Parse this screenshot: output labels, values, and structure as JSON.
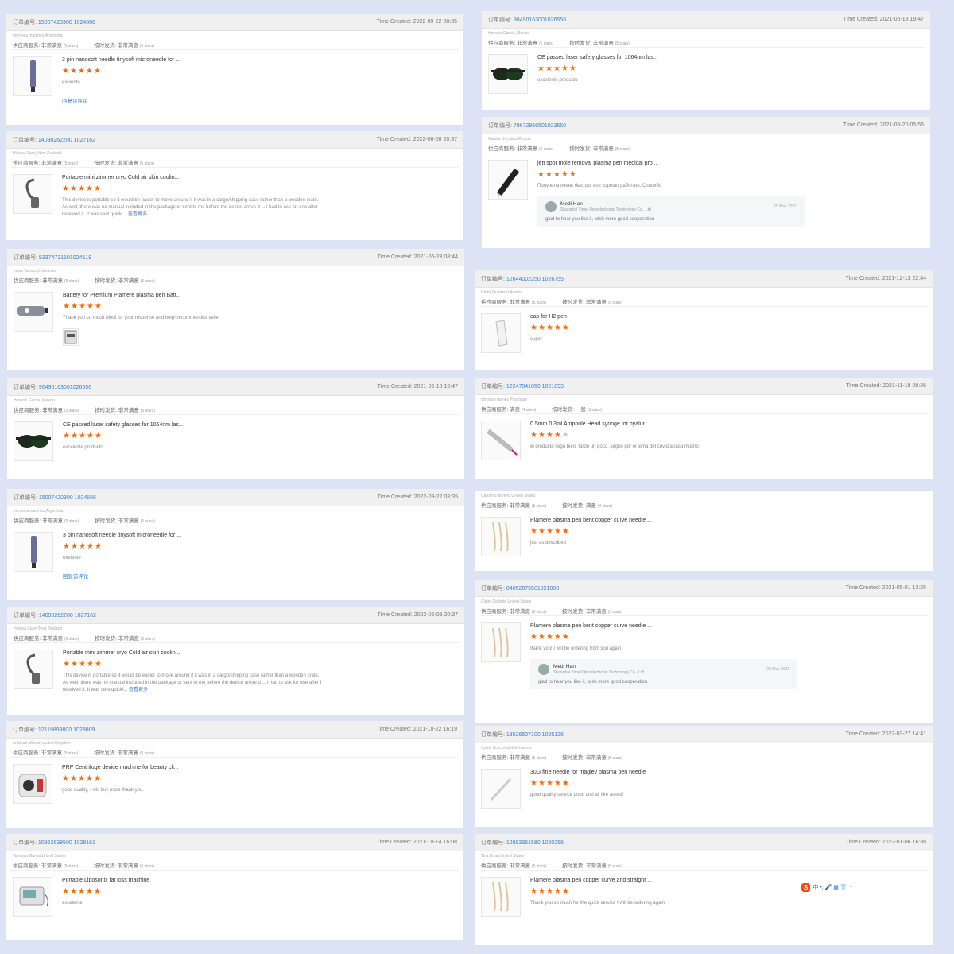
{
  "labels": {
    "order_no": "订单编号:",
    "time_created": "Time Created:",
    "supplier": "供应商服务:",
    "shipping": "按时发货:",
    "reply_link": "回复该评论",
    "read_more": "查看更多"
  },
  "left_column": [
    {
      "order_id": "15007420300 1024666",
      "time": "2022-09-22 08:35",
      "customer": "veronica martinez,Argentina",
      "supplier_rating": "非常满意",
      "supplier_stars": "(5 stars)",
      "shipping_rating": "非常满意",
      "shipping_stars": "(5 stars)",
      "product": "3 pin nanosoft needle tinysoft microneedle for ...",
      "stars": 5,
      "review": "exelente",
      "reply_link": true
    },
    {
      "order_id": "14090262200 1027162",
      "time": "2022-06-08 20:37",
      "customer": "Helena Carey,New Zealand",
      "supplier_rating": "非常满意",
      "supplier_stars": "(5 stars)",
      "shipping_rating": "非常满意",
      "shipping_stars": "(5 stars)",
      "product": "Portable mini zimmer cryo Cold air skin coolin...",
      "stars": 5,
      "review": "This device is portable so it would be easier to move around if it was in a cargo/shipping case rather than a wooden crate. As well, there was no manual included in the package or sent to me before the device arrive d ... i had to ask for one after I received it. It was sent quickl...",
      "read_more": true
    },
    {
      "order_id": "93374731501024519",
      "time": "2021-06-23 08:44",
      "customer": "Irwan Tanoso,Indonesia",
      "supplier_rating": "非常满意",
      "supplier_stars": "(5 stars)",
      "shipping_rating": "非常满意",
      "shipping_stars": "(5 stars)",
      "product": "Battery for Premium Plamere plasma pen Batt...",
      "stars": 5,
      "review": "Thank you so much Medi for your response and help! recommended seller",
      "photo": true
    },
    {
      "order_id": "90490163001026556",
      "time": "2021-06-18 19:47",
      "customer": "Horacio Garcia ,Mexico",
      "supplier_rating": "非常满意",
      "supplier_stars": "(5 stars)",
      "shipping_rating": "非常满意",
      "shipping_stars": "(5 stars)",
      "product": "CE passed laser safety glasses for 1064nm las...",
      "stars": 5,
      "review": "excelente producto"
    },
    {
      "order_id": "15007420300 1024666",
      "time": "2022-09-22 08:35",
      "customer": "veronica martinez,Argentina",
      "supplier_rating": "非常满意",
      "supplier_stars": "(5 stars)",
      "shipping_rating": "非常满意",
      "shipping_stars": "(5 stars)",
      "product": "3 pin nanosoft needle tinysoft microneedle for ...",
      "stars": 5,
      "review": "exelente",
      "reply_link": true
    },
    {
      "order_id": "14090262200 1027162",
      "time": "2022-06-08 20:37",
      "customer": "Helena Carey,New Zealand",
      "supplier_rating": "非常满意",
      "supplier_stars": "(5 stars)",
      "shipping_rating": "非常满意",
      "shipping_stars": "(5 stars)",
      "product": "Portable mini zimmer cryo Cold air skin coolin...",
      "stars": 5,
      "review": "This device is portable so it would be easier to move around if it was in a cargo/shipping case rather than a wooden crate. As well, there was no manual included in the package or sent to me before the device arrive d ... i had to ask for one after I received it. It was sent quickl...",
      "read_more": true
    },
    {
      "order_id": "12119899800 1028809",
      "time": "2021-10-22 16:19",
      "customer": "m fahad afsham,United Kingdom",
      "supplier_rating": "非常满意",
      "supplier_stars": "(5 stars)",
      "shipping_rating": "非常满意",
      "shipping_stars": "(5 stars)",
      "product": "PRP Centrifuge device machine for beauty cli...",
      "stars": 5,
      "review": "good quality, I will buy more thank you."
    },
    {
      "order_id": "10963639500 1028161",
      "time": "2021-10-14 16:08",
      "customer": "Vanessa Garcia,United States",
      "supplier_rating": "非常满意",
      "supplier_stars": "(5 stars)",
      "shipping_rating": "非常满意",
      "shipping_stars": "(5 stars)",
      "product": "Portable Liposonix fat loss machine",
      "stars": 5,
      "review": "excelente"
    }
  ],
  "right_column": [
    {
      "order_id": "90490163001026556",
      "time": "2021-06-18 19:47",
      "customer": "Horacio Garcia ,Mexico",
      "supplier_rating": "非常满意",
      "supplier_stars": "(5 stars)",
      "shipping_rating": "非常满意",
      "shipping_stars": "(5 stars)",
      "product": "CE passed laser safety glasses for 1064nm las...",
      "stars": 5,
      "review": "excelente producto"
    },
    {
      "order_id": "79672966501023650",
      "time": "2021-05-20 05:56",
      "customer": "Natalia Borodina,Russia",
      "supplier_rating": "非常满意",
      "supplier_stars": "(5 stars)",
      "shipping_rating": "非常满意",
      "shipping_stars": "(5 stars)",
      "product": "jett spot mole removal plasma pen medical pro...",
      "stars": 5,
      "review": "Получила очень быстро, все хорошо работает. Спасибо",
      "reply": {
        "name": "Medi Han",
        "company": "Shanghai Yimei Optoelectronic Technology Co., Ltd",
        "date": "20 May 2021",
        "message": "glad to hear you like it, wish more good cooperation"
      }
    },
    {
      "order_id": "12644002250 1026755",
      "time": "2021-12-13 22:44",
      "customer": "Ulrike Quaderer,Austria",
      "supplier_rating": "非常满意",
      "supplier_stars": "(5 stars)",
      "shipping_rating": "非常满意",
      "shipping_stars": "(5 stars)",
      "product": "cap for H2 pen",
      "stars": 5,
      "review": "super"
    },
    {
      "order_id": "12247941050 1021893",
      "time": "2021-11-18 08:26",
      "customer": "christian gomez,Paraguay",
      "supplier_rating": "满意",
      "supplier_stars": "(4 stars)",
      "shipping_rating": "一般",
      "shipping_stars": "(3 stars)",
      "product": "0.5mm 0.3ml Ampoule Head syringe for hyalur...",
      "stars": 4,
      "review": "el producto llegó bien, tardo un poco, según por el tema del covid atrasa mucho"
    },
    {
      "order_id": "",
      "time": "",
      "customer": "Carolina Moreno,United States",
      "supplier_rating": "非常满意",
      "supplier_stars": "(5 stars)",
      "shipping_rating": "满意",
      "shipping_stars": "(4 stars)",
      "product": "Plamere plasma pen bent copper curve needle ...",
      "stars": 5,
      "review": "just as described"
    },
    {
      "order_id": "84052075501021083",
      "time": "2021-05-01 13:25",
      "customer": "Claire Cadotte,United States",
      "supplier_rating": "非常满意",
      "supplier_stars": "(5 stars)",
      "shipping_rating": "非常满意",
      "shipping_stars": "(5 stars)",
      "product": "Plamere plasma pen bent copper curve needle ...",
      "stars": 5,
      "review": "thank you! I will be ordering from you again!",
      "reply": {
        "name": "Medi Han",
        "company": "Shanghai Yimei Optoelectronic Technology Co., Ltd",
        "date": "20 May 2021",
        "message": "glad to hear you like it, wish more good cooperation"
      }
    },
    {
      "order_id": "13526507100 1025126",
      "time": "2022-03-27 14:41",
      "customer": "Sylvia Scoccina,Netherlands",
      "supplier_rating": "非常满意",
      "supplier_stars": "(5 stars)",
      "shipping_rating": "非常满意",
      "shipping_stars": "(5 stars)",
      "product": "30G fine needle for maglev plasma pen needle",
      "stars": 5,
      "review": "good quality service good and all like asked!"
    },
    {
      "order_id": "12893361580 1020256",
      "time": "2022-01-06 16:38",
      "customer": "Tina Doan,United States",
      "supplier_rating": "非常满意",
      "supplier_stars": "(5 stars)",
      "shipping_rating": "非常满意",
      "shipping_stars": "(5 stars)",
      "product": "Plamere plasma pen copper curve and straight ...",
      "stars": 5,
      "review": "Thank you so much for the quick service I will be ordering again"
    }
  ],
  "toolbar": {
    "logo": "S",
    "items": "中 •, 🎤 ▦ 👕 ⁘"
  }
}
